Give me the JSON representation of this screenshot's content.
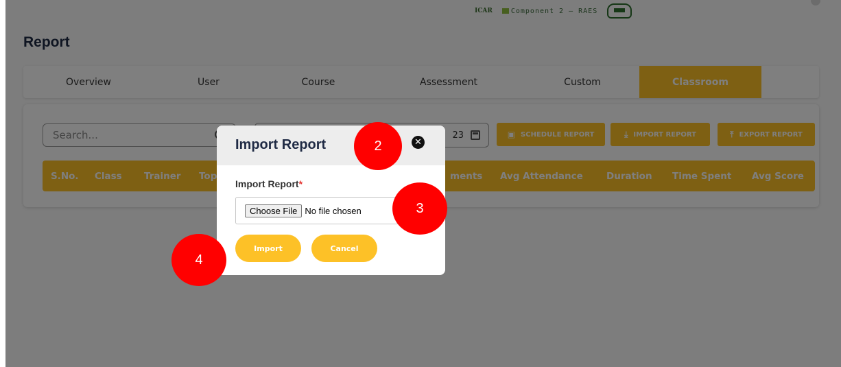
{
  "header": {
    "logo_icar": "ICAR",
    "logo_component": "Component 2 — RAES",
    "page_title": "Report"
  },
  "tabs": [
    {
      "label": "Overview"
    },
    {
      "label": "User"
    },
    {
      "label": "Course"
    },
    {
      "label": "Assessment"
    },
    {
      "label": "Custom"
    },
    {
      "label": "Classroom",
      "active": true
    }
  ],
  "toolbar": {
    "search_placeholder": "Search...",
    "date_value": "23",
    "schedule_label": "SCHEDULE REPORT",
    "import_label": "IMPORT REPORT",
    "export_label": "EXPORT REPORT"
  },
  "table": {
    "columns": [
      "S.No.",
      "Class",
      "Trainer",
      "Top",
      "ments",
      "Avg Attendance",
      "Duration",
      "Time Spent",
      "Avg Score"
    ]
  },
  "modal": {
    "title": "Import Report",
    "field_label": "Import Report",
    "required_mark": "*",
    "choose_file_label": "Choose File",
    "file_status": "No file chosen",
    "import_label": "Import",
    "cancel_label": "Cancel"
  },
  "annotations": {
    "marker_2": "2",
    "marker_3": "3",
    "marker_4": "4"
  },
  "colors": {
    "accent": "#fdc127",
    "marker": "#ff0000",
    "title": "#1f2a44"
  },
  "icons": {
    "search": "search-icon",
    "calendar": "calendar-icon",
    "close": "close-icon",
    "download": "download-icon",
    "upload": "upload-icon"
  }
}
